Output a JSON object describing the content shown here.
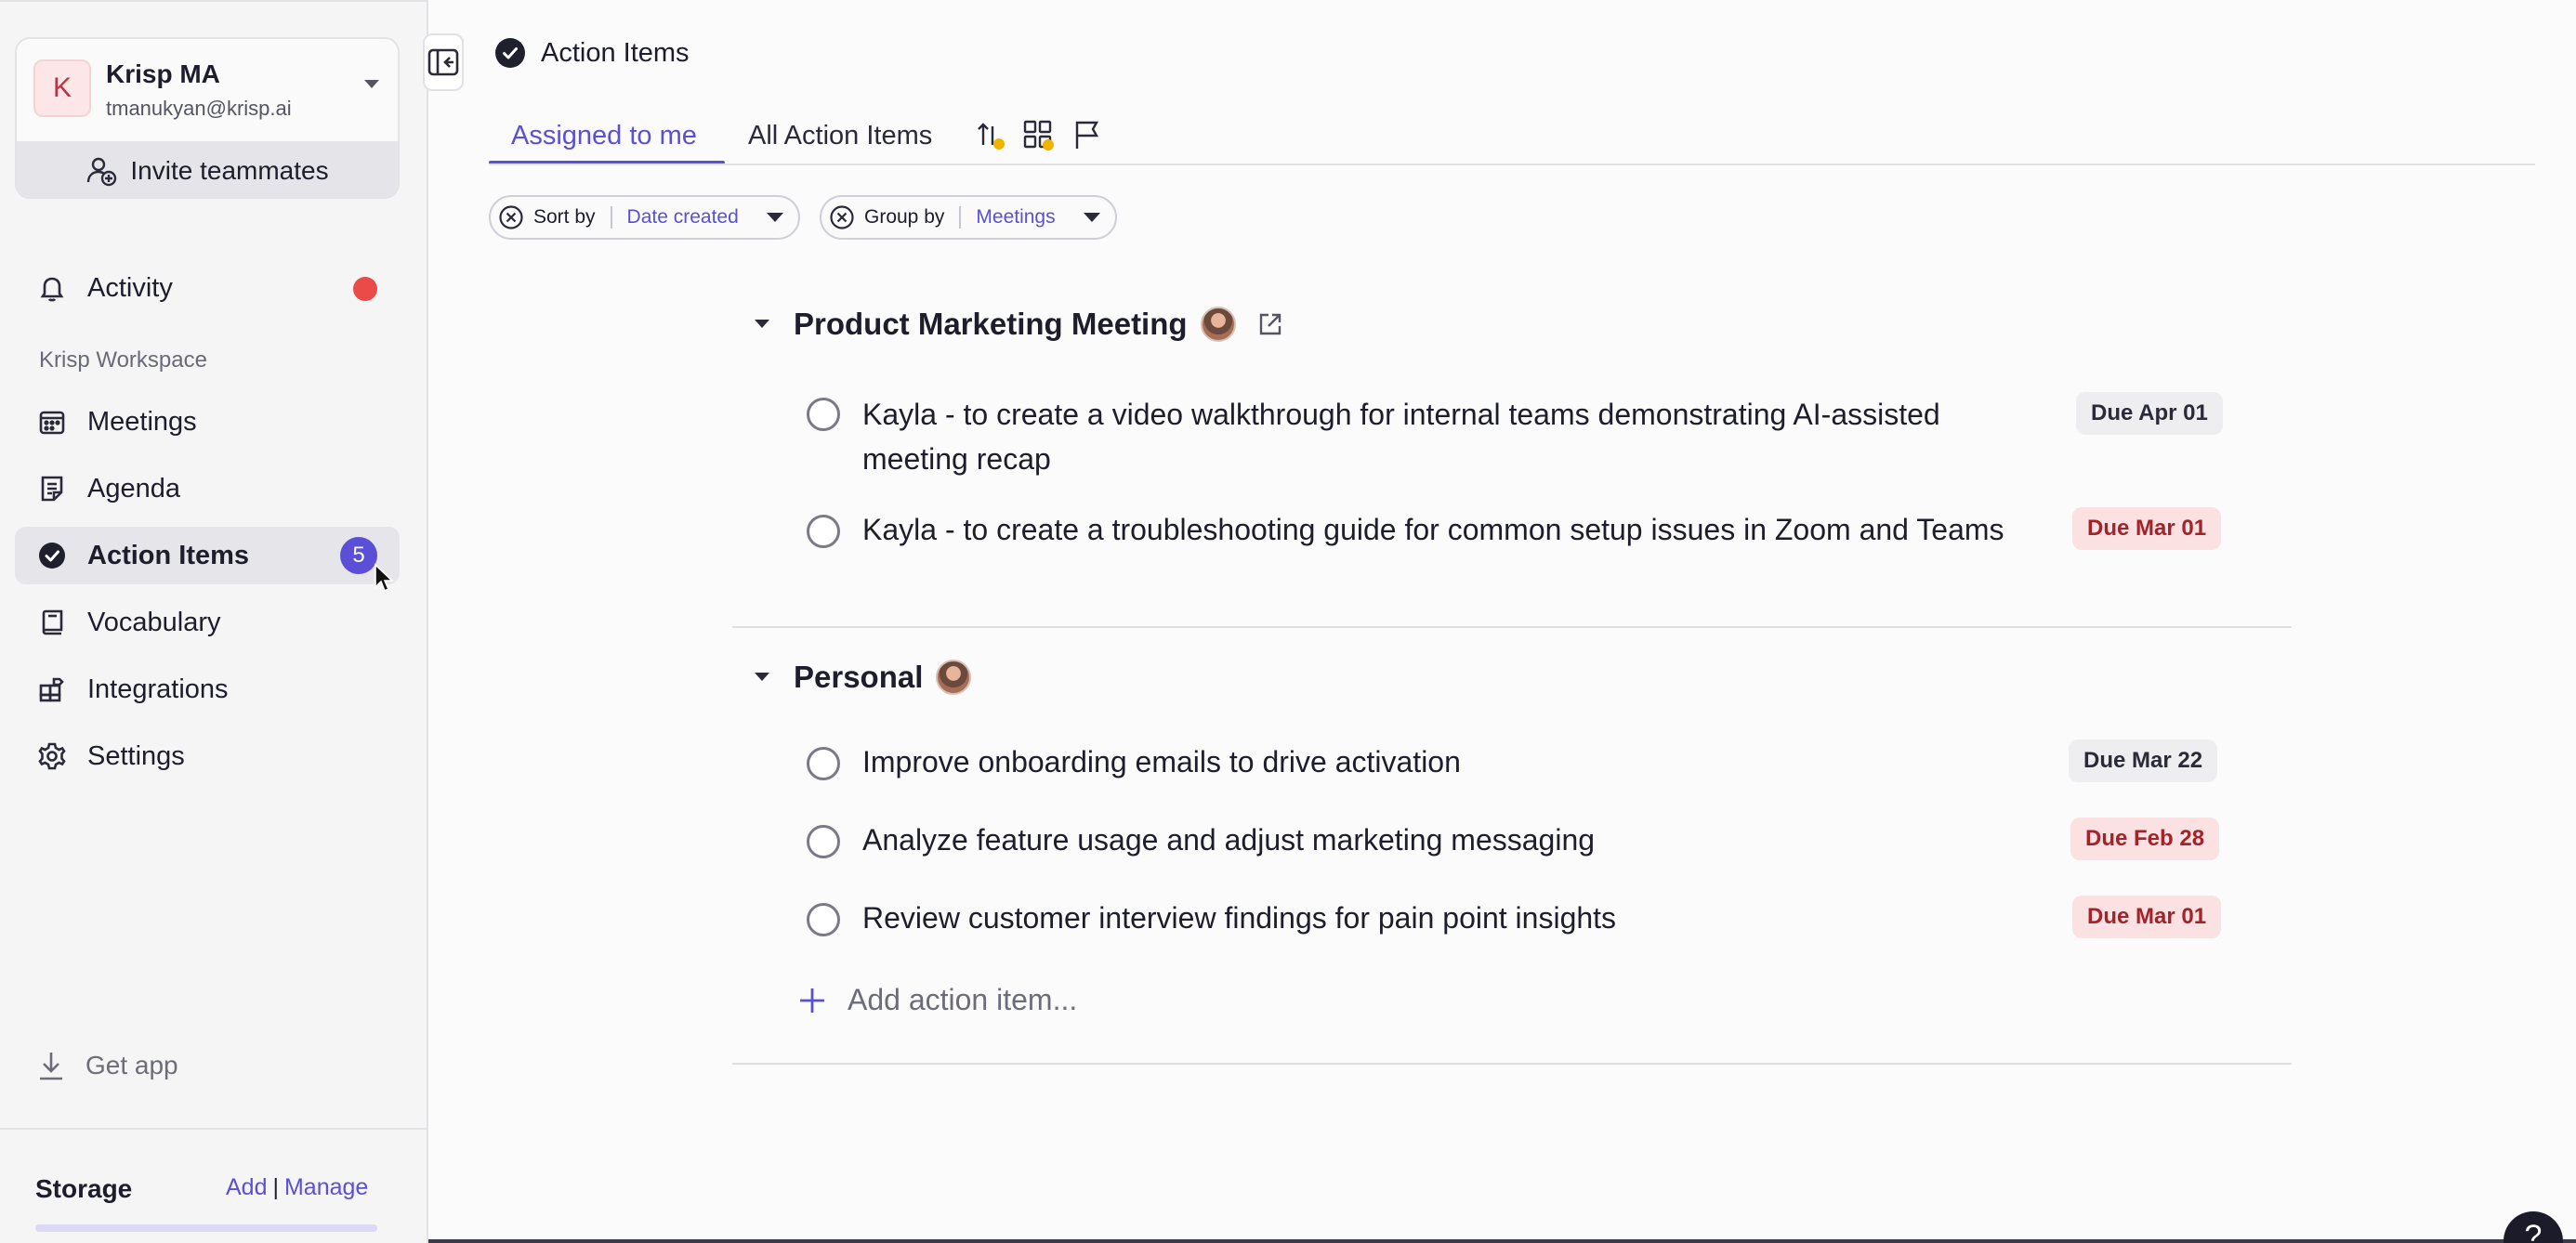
{
  "account": {
    "initial": "K",
    "name": "Krisp MA",
    "email": "tmanukyan@krisp.ai",
    "invite_label": "Invite teammates"
  },
  "sidebar": {
    "activity_label": "Activity",
    "workspace_label": "Krisp Workspace",
    "items": [
      {
        "label": "Meetings",
        "icon": "calendar-icon"
      },
      {
        "label": "Agenda",
        "icon": "document-icon"
      },
      {
        "label": "Action Items",
        "icon": "check-circle-icon",
        "badge": "5"
      },
      {
        "label": "Vocabulary",
        "icon": "book-icon"
      },
      {
        "label": "Integrations",
        "icon": "puzzle-icon"
      },
      {
        "label": "Settings",
        "icon": "gear-icon"
      }
    ],
    "get_app_label": "Get app",
    "storage_label": "Storage",
    "storage_add": "Add",
    "storage_manage": "Manage"
  },
  "header": {
    "title": "Action Items"
  },
  "tabs": [
    {
      "label": "Assigned to me",
      "active": true
    },
    {
      "label": "All Action Items",
      "active": false
    }
  ],
  "filters": {
    "sort_label": "Sort by",
    "sort_value": "Date created",
    "group_label": "Group by",
    "group_value": "Meetings"
  },
  "groups": [
    {
      "title": "Product Marketing Meeting",
      "items": [
        {
          "text": "Kayla - to create a video walkthrough for internal teams demonstrating AI-assisted meeting recap",
          "due": "Due Apr 01",
          "overdue": false
        },
        {
          "text": "Kayla - to create a troubleshooting guide for common setup issues in Zoom and Teams",
          "due": "Due Mar 01",
          "overdue": true
        }
      ]
    },
    {
      "title": "Personal",
      "items": [
        {
          "text": "Improve onboarding emails to drive activation",
          "due": "Due Mar 22",
          "overdue": false
        },
        {
          "text": "Analyze feature usage and adjust marketing messaging",
          "due": "Due Feb 28",
          "overdue": true
        },
        {
          "text": "Review customer interview findings for pain point insights",
          "due": "Due Mar 01",
          "overdue": true
        }
      ]
    }
  ],
  "add_item_placeholder": "Add action item...",
  "help_label": "?",
  "colors": {
    "accent": "#5a4fd6",
    "overdue_bg": "#fbe1e1",
    "overdue_text": "#a3232b",
    "notification": "#ea4a48"
  }
}
